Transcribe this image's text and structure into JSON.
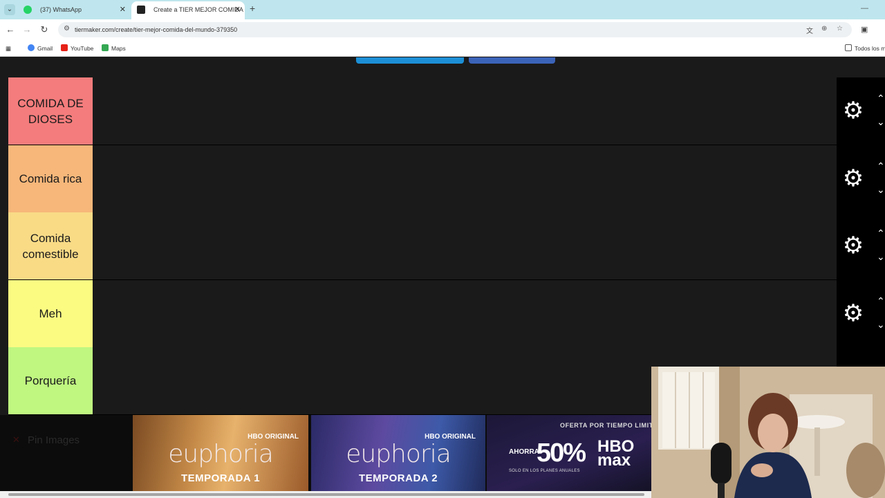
{
  "browser": {
    "tabs": [
      {
        "title": "(37) WhatsApp",
        "active": false
      },
      {
        "title": "Create a TIER MEJOR COMIDA",
        "active": true
      }
    ],
    "url": "tiermaker.com/create/tier-mejor-comida-del-mundo-379350",
    "bookmarks": [
      "Gmail",
      "YouTube",
      "Maps"
    ],
    "bookmarks_folder": "Todos los m"
  },
  "tiers": [
    {
      "label": "COMIDA DE DIOSES",
      "color": "#f47c7c"
    },
    {
      "label": "Comida rica",
      "color": "#f7b77a"
    },
    {
      "label": "Comida comestible",
      "color": "#f9db86"
    },
    {
      "label": "Meh",
      "color": "#fbfb82"
    },
    {
      "label": "Porquería",
      "color": "#bff780"
    }
  ],
  "pin_images_label": "Pin Images",
  "ads": [
    {
      "brand": "HBO ORIGINAL",
      "show": "euphoria",
      "season": "TEMPORADA 1"
    },
    {
      "brand": "HBO ORIGINAL",
      "show": "euphoria",
      "season": "TEMPORADA 2"
    },
    {
      "offer": "OFERTA POR TIEMPO LIMITADO",
      "save": "AHORRA",
      "percent": "50%",
      "brand": "HBO max",
      "plans": "SOLO EN LOS PLANES ANUALES"
    }
  ],
  "colors": {
    "tabstrip": "#bfe6ee",
    "page_bg": "#1a1a1a",
    "accent_button_1": "#1c8fd6",
    "accent_button_2": "#3b63b8"
  }
}
